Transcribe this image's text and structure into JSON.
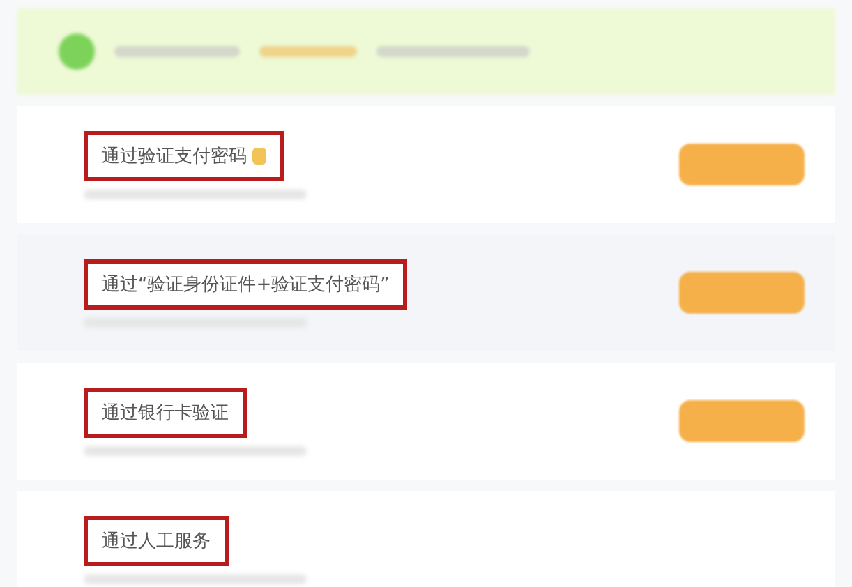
{
  "options": [
    {
      "label": "通过验证支付密码",
      "badge": true,
      "button": true,
      "selected": false
    },
    {
      "label": "通过“验证身份证件+验证支付密码”",
      "badge": false,
      "button": true,
      "selected": true
    },
    {
      "label": "通过银行卡验证",
      "badge": false,
      "button": true,
      "selected": false
    },
    {
      "label": "通过人工服务",
      "badge": false,
      "button": false,
      "selected": false
    }
  ]
}
